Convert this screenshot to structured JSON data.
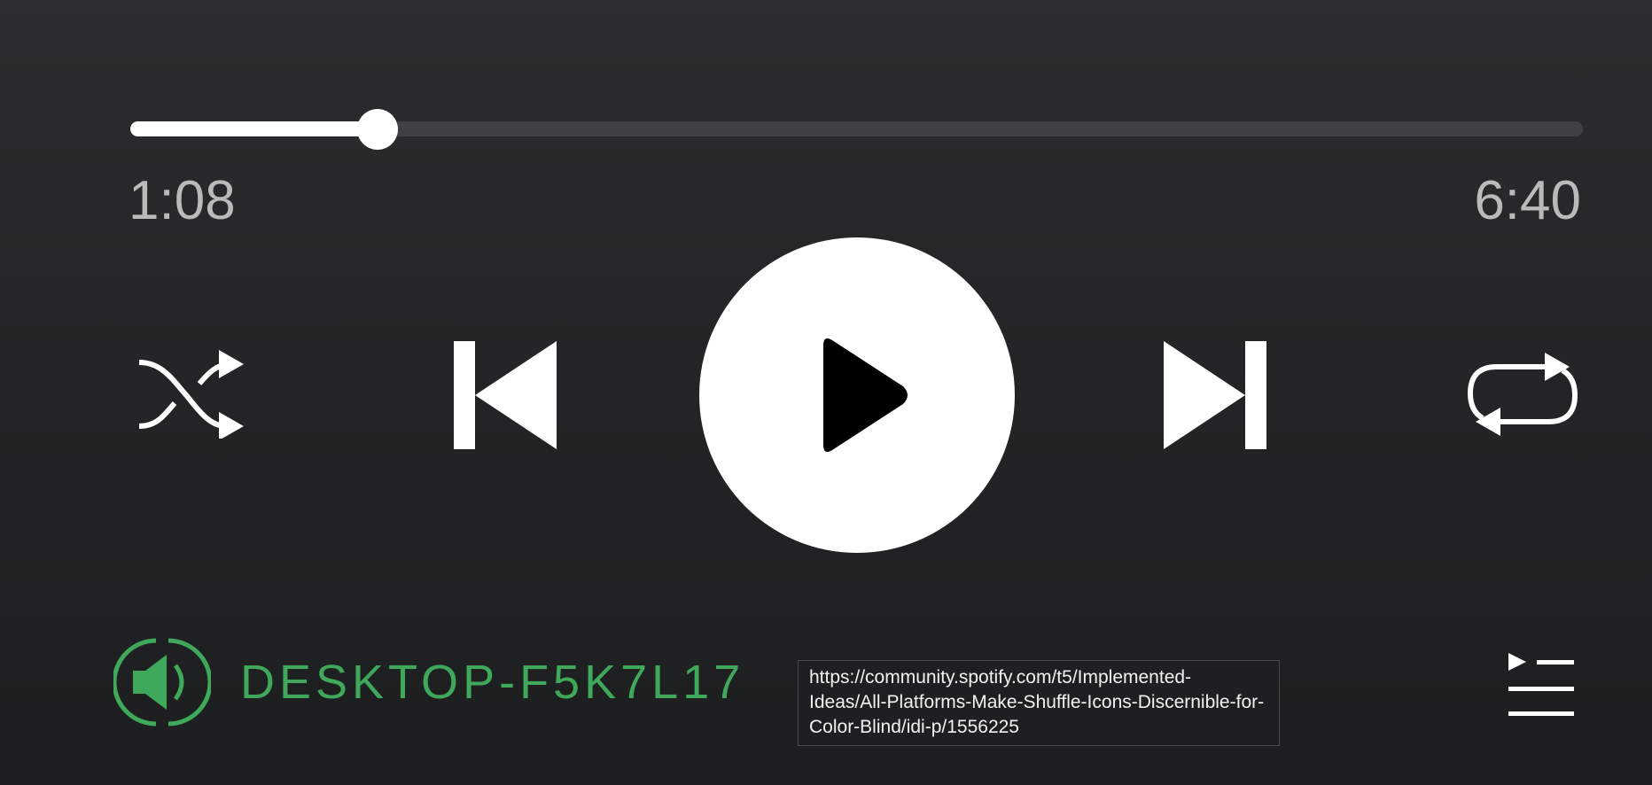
{
  "player": {
    "elapsed": "1:08",
    "total": "6:40",
    "progress_fraction": 0.17
  },
  "controls": {
    "shuffle_icon": "shuffle-icon",
    "previous_icon": "skip-back-icon",
    "play_icon": "play-icon",
    "next_icon": "skip-forward-icon",
    "repeat_icon": "repeat-icon",
    "queue_icon": "queue-icon"
  },
  "device": {
    "name": "DESKTOP-F5K7L17",
    "icon": "speaker-icon",
    "color": "#3fa85b"
  },
  "tooltip": {
    "text": "https://community.spotify.com/t5/Implemented-Ideas/All-Platforms-Make-Shuffle-Icons-Discernible-for-Color-Blind/idi-p/1556225"
  },
  "colors": {
    "background": "#232526",
    "track": "#3f4142",
    "accent": "#ffffff",
    "time_text": "#b9baba"
  }
}
